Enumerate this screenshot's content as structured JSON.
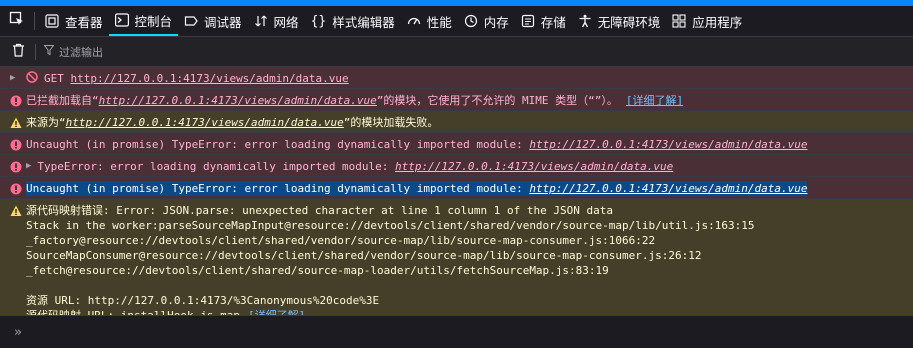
{
  "toolbar": {
    "tabs": [
      {
        "label": "查看器",
        "icon": "inspector-icon"
      },
      {
        "label": "控制台",
        "icon": "console-icon"
      },
      {
        "label": "调试器",
        "icon": "debugger-icon"
      },
      {
        "label": "网络",
        "icon": "network-icon"
      },
      {
        "label": "样式编辑器",
        "icon": "style-editor-icon"
      },
      {
        "label": "性能",
        "icon": "performance-icon"
      },
      {
        "label": "内存",
        "icon": "memory-icon"
      },
      {
        "label": "存储",
        "icon": "storage-icon"
      },
      {
        "label": "无障碍环境",
        "icon": "accessibility-icon"
      },
      {
        "label": "应用程序",
        "icon": "application-icon"
      }
    ],
    "active_tab": "控制台"
  },
  "filter": {
    "placeholder": "过滤输出"
  },
  "messages": {
    "m1_prefix": "GET ",
    "m1_url": "http://127.0.0.1:4173/views/admin/data.vue",
    "m2_prefix": "已拦截加载自“",
    "m2_url": "http://127.0.0.1:4173/views/admin/data.vue",
    "m2_suffix": "”的模块，它使用了不允许的 MIME 类型（“”）。",
    "m2_learn": "[详细了解]",
    "m3_prefix": "来源为“",
    "m3_url": "http://127.0.0.1:4173/views/admin/data.vue",
    "m3_suffix": "”的模块加载失败。",
    "m4_prefix": "Uncaught (in promise) TypeError: error loading dynamically imported module: ",
    "m4_url": "http://127.0.0.1:4173/views/admin/data.vue",
    "m5_prefix": "TypeError: error loading dynamically imported module: ",
    "m5_url": "http://127.0.0.1:4173/views/admin/data.vue",
    "m6_prefix": "Uncaught (in promise) TypeError: error loading dynamically imported module: ",
    "m6_url": "http://127.0.0.1:4173/views/admin/data.vue",
    "sm_lines": [
      "源代码映射错误: Error: JSON.parse: unexpected character at line 1 column 1 of the JSON data",
      "Stack in the worker:parseSourceMapInput@resource://devtools/client/shared/vendor/source-map/lib/util.js:163:15",
      "_factory@resource://devtools/client/shared/vendor/source-map/lib/source-map-consumer.js:1066:22",
      "SourceMapConsumer@resource://devtools/client/shared/vendor/source-map/lib/source-map-consumer.js:26:12",
      "_fetch@resource://devtools/client/shared/source-map-loader/utils/fetchSourceMap.js:83:19",
      "",
      "资源 URL: http://127.0.0.1:4173/%3Canonymous%20code%3E"
    ],
    "sm_last_prefix": "源代码映射 URL: installHook.js.map",
    "sm_learn": "[详细了解]"
  },
  "prompt": {
    "symbol": "»"
  }
}
